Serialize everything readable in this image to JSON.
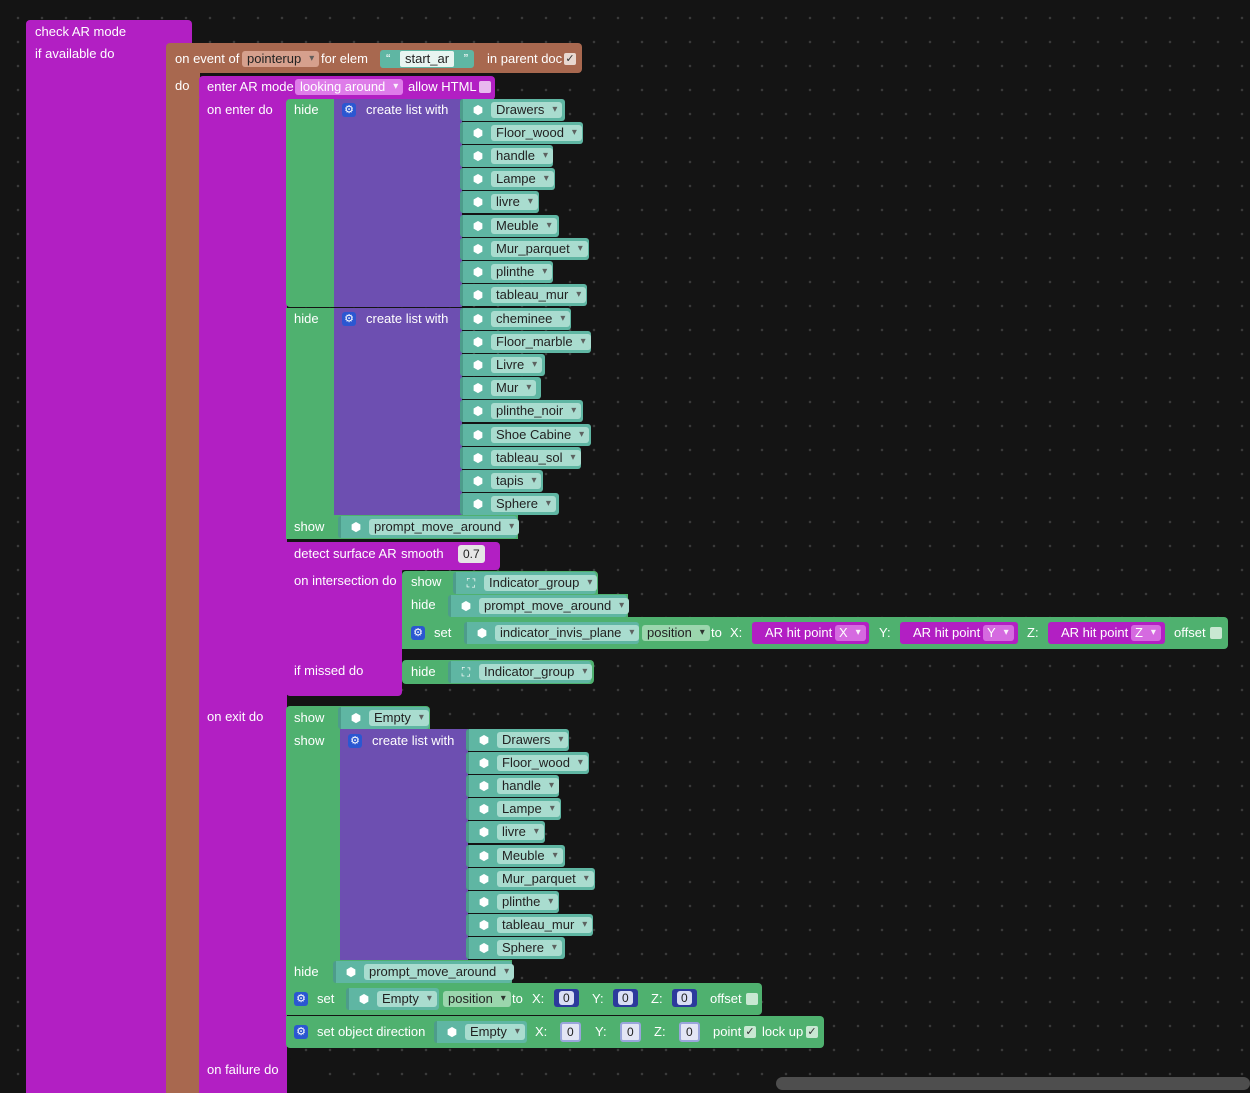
{
  "root": {
    "title": "check AR mode",
    "subtitle": "if available do",
    "on_failure": "on failure do"
  },
  "event": {
    "prefix": "on event of",
    "event_name": "pointerup",
    "for_elem": "for elem",
    "elem_id": "start_ar",
    "in_parent": "in parent doc",
    "in_parent_checked": true,
    "do": "do"
  },
  "enter_ar": {
    "label": "enter AR mode",
    "mode": "looking around",
    "allow_html": "allow HTML",
    "on_enter": "on enter do",
    "on_exit": "on exit do"
  },
  "hide_label": "hide",
  "show_label": "show",
  "set_label": "set",
  "to_label": "to",
  "create_list": "create list with",
  "hide_list_1": [
    "Drawers",
    "Floor_wood",
    "handle",
    "Lampe",
    "livre",
    "Meuble",
    "Mur_parquet",
    "plinthe",
    "tableau_mur"
  ],
  "hide_list_2": [
    "cheminee",
    "Floor_marble",
    "Livre",
    "Mur",
    "plinthe_noir",
    "Shoe Cabine",
    "tableau_sol",
    "tapis",
    "Sphere"
  ],
  "show_prompt": "prompt_move_around",
  "detect": {
    "label": "detect surface AR",
    "smooth": "smooth",
    "smooth_value": "0.7",
    "on_intersection": "on intersection do",
    "if_missed": "if missed do"
  },
  "intersection": {
    "show_obj": "Indicator_group",
    "hide_obj": "prompt_move_around",
    "set_obj": "indicator_invis_plane",
    "property": "position",
    "x": "X:",
    "y": "Y:",
    "z": "Z:",
    "hit_label": "AR hit point",
    "hit_x": "X",
    "hit_y": "Y",
    "hit_z": "Z",
    "offset": "offset"
  },
  "missed_hide": "Indicator_group",
  "exit": {
    "show_obj": "Empty",
    "show_list": [
      "Drawers",
      "Floor_wood",
      "handle",
      "Lampe",
      "livre",
      "Meuble",
      "Mur_parquet",
      "plinthe",
      "tableau_mur",
      "Sphere"
    ],
    "hide_obj": "prompt_move_around",
    "set_obj": "Empty",
    "property": "position",
    "x_val": "0",
    "y_val": "0",
    "z_val": "0",
    "offset": "offset",
    "dir_label": "set object direction",
    "dir_obj": "Empty",
    "dx": "0",
    "dy": "0",
    "dz": "0",
    "point": "point",
    "lock_up": "lock up"
  }
}
